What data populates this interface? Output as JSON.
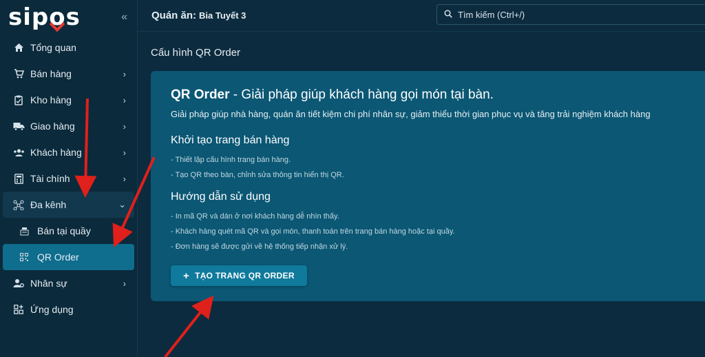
{
  "brand": {
    "logo_text": "sipos"
  },
  "sidebar": {
    "items": [
      {
        "label": "Tổng quan",
        "icon": "home-icon",
        "chevron": false
      },
      {
        "label": "Bán hàng",
        "icon": "cart-icon",
        "chevron": true
      },
      {
        "label": "Kho hàng",
        "icon": "clipboard-icon",
        "chevron": true
      },
      {
        "label": "Giao hàng",
        "icon": "truck-icon",
        "chevron": true
      },
      {
        "label": "Khách hàng",
        "icon": "users-icon",
        "chevron": true
      },
      {
        "label": "Tài chính",
        "icon": "calculator-icon",
        "chevron": true
      },
      {
        "label": "Đa kênh",
        "icon": "network-icon",
        "chevron": true,
        "expanded": true
      },
      {
        "label": "Bán tại quầy",
        "icon": "counter-icon",
        "sub": true
      },
      {
        "label": "QR Order",
        "icon": "qr-icon",
        "sub": true,
        "active": true
      },
      {
        "label": "Nhân sự",
        "icon": "staff-icon",
        "chevron": true
      },
      {
        "label": "Ứng dụng",
        "icon": "apps-icon",
        "chevron": false
      }
    ]
  },
  "header": {
    "shop_label": "Quán ăn:",
    "shop_name": "Bia Tuyết 3",
    "search_placeholder": "Tìm kiếm (Ctrl+/)"
  },
  "page": {
    "title": "Cấu hình QR Order"
  },
  "card": {
    "heading_bold": "QR Order",
    "heading_rest": " - Giải pháp giúp khách hàng gọi món tại bàn.",
    "description": "Giải pháp giúp nhà hàng, quán ăn tiết kiệm chi phí nhân sự, giảm thiểu thời gian phục vụ và tăng trải nghiệm khách hàng",
    "section1_title": "Khởi tạo trang bán hàng",
    "section1_items": [
      "- Thiết lập cấu hình trang bán hàng.",
      "- Tạo QR theo bàn, chỉnh sửa thông tin hiển thị QR."
    ],
    "section2_title": "Hướng dẫn sử dụng",
    "section2_items": [
      "- In mã QR và dán ở nơi khách hàng dễ nhìn thấy.",
      "- Khách hàng quét mã QR và gọi món, thanh toán trên trang bán hàng hoặc tại quầy.",
      "- Đơn hàng sẽ được gửi về hệ thống tiếp nhận xử lý."
    ],
    "button_label": "TẠO TRANG QR ORDER"
  },
  "colors": {
    "accent": "#0f6d8e",
    "card_bg": "#0b5774",
    "annotation_arrow": "#e0201b"
  }
}
